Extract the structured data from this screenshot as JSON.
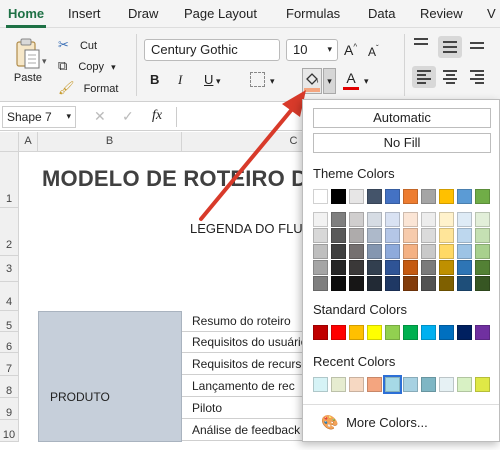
{
  "tabs": [
    "Home",
    "Insert",
    "Draw",
    "Page Layout",
    "Formulas",
    "Data",
    "Review",
    "V"
  ],
  "clipboard": {
    "paste": "Paste",
    "cut": "Cut",
    "copy": "Copy",
    "format": "Format"
  },
  "font": {
    "name": "Century Gothic",
    "size": "10"
  },
  "formula_bar": {
    "name_box": "Shape 7",
    "fx": "fx"
  },
  "columns": [
    "A",
    "B",
    "C"
  ],
  "rows": [
    "1",
    "2",
    "3",
    "4",
    "5",
    "6",
    "7",
    "8",
    "9",
    "10"
  ],
  "sheet": {
    "title": "MODELO DE ROTEIRO DO",
    "legend": "LEGENDA DO FLU",
    "product_label": "PRODUTO",
    "items": [
      "Resumo do roteiro",
      "Requisitos do usuário",
      "Requisitos de recursos",
      "Lançamento de rec",
      "Piloto",
      "Análise de feedback"
    ]
  },
  "color_menu": {
    "automatic": "Automatic",
    "no_fill": "No Fill",
    "theme_title": "Theme Colors",
    "standard_title": "Standard Colors",
    "recent_title": "Recent Colors",
    "more": "More Colors...",
    "theme_top": [
      "#ffffff",
      "#000000",
      "#e7e6e6",
      "#44546a",
      "#4472c4",
      "#ed7d31",
      "#a5a5a5",
      "#ffc000",
      "#5b9bd5",
      "#70ad47"
    ],
    "theme_shades": [
      [
        "#f2f2f2",
        "#7f7f7f",
        "#d0cece",
        "#d6dce4",
        "#d9e2f3",
        "#fbe5d5",
        "#ededed",
        "#fff2cc",
        "#deebf6",
        "#e2efd9"
      ],
      [
        "#d8d8d8",
        "#595959",
        "#aeabab",
        "#adb9ca",
        "#b4c6e7",
        "#f7cbac",
        "#dbdbdb",
        "#ffe599",
        "#bdd7ee",
        "#c5e0b3"
      ],
      [
        "#bfbfbf",
        "#3f3f3f",
        "#757070",
        "#8496b0",
        "#8eaadb",
        "#f4b183",
        "#c9c9c9",
        "#ffd965",
        "#9cc3e5",
        "#a8d08d"
      ],
      [
        "#a5a5a5",
        "#262626",
        "#3a3838",
        "#323f4f",
        "#2f5496",
        "#c55a11",
        "#7b7b7b",
        "#bf9000",
        "#2e75b5",
        "#538135"
      ],
      [
        "#7f7f7f",
        "#0c0c0c",
        "#171616",
        "#222a35",
        "#1f3864",
        "#833c0b",
        "#525252",
        "#7f6000",
        "#1e4e79",
        "#375623"
      ]
    ],
    "standard": [
      "#c00000",
      "#ff0000",
      "#ffc000",
      "#ffff00",
      "#92d050",
      "#00b050",
      "#00b0f0",
      "#0070c0",
      "#002060",
      "#7030a0"
    ],
    "recent": [
      "#d6f3f6",
      "#e6ecd0",
      "#f6d8c2",
      "#f4a57f",
      "#a6d9e6",
      "#a7d1e2",
      "#7fb6c4",
      "#e6f1f4",
      "#d8f1c4",
      "#dfe846"
    ],
    "recent_selected_index": 4
  }
}
